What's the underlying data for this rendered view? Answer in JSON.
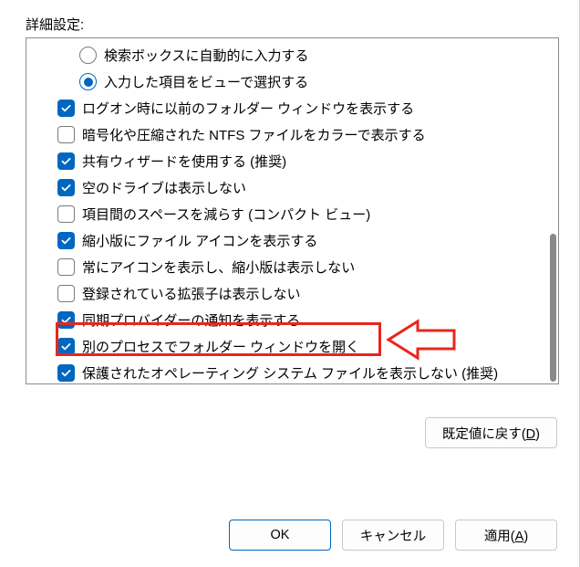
{
  "section_label": "詳細設定:",
  "options": [
    {
      "type": "radio",
      "checked": false,
      "sub": true,
      "label": "検索ボックスに自動的に入力する"
    },
    {
      "type": "radio",
      "checked": true,
      "sub": true,
      "label": "入力した項目をビューで選択する"
    },
    {
      "type": "checkbox",
      "checked": true,
      "sub": false,
      "label": "ログオン時に以前のフォルダー ウィンドウを表示する"
    },
    {
      "type": "checkbox",
      "checked": false,
      "sub": false,
      "label": "暗号化や圧縮された NTFS ファイルをカラーで表示する"
    },
    {
      "type": "checkbox",
      "checked": true,
      "sub": false,
      "label": "共有ウィザードを使用する (推奨)"
    },
    {
      "type": "checkbox",
      "checked": true,
      "sub": false,
      "label": "空のドライブは表示しない"
    },
    {
      "type": "checkbox",
      "checked": false,
      "sub": false,
      "label": "項目間のスペースを減らす (コンパクト ビュー)"
    },
    {
      "type": "checkbox",
      "checked": true,
      "sub": false,
      "label": "縮小版にファイル アイコンを表示する"
    },
    {
      "type": "checkbox",
      "checked": false,
      "sub": false,
      "label": "常にアイコンを表示し、縮小版は表示しない"
    },
    {
      "type": "checkbox",
      "checked": false,
      "sub": false,
      "label": "登録されている拡張子は表示しない"
    },
    {
      "type": "checkbox",
      "checked": true,
      "sub": false,
      "label": "同期プロバイダーの通知を表示する"
    },
    {
      "type": "checkbox",
      "checked": true,
      "sub": false,
      "label": "別のプロセスでフォルダー ウィンドウを開く"
    },
    {
      "type": "checkbox",
      "checked": true,
      "sub": false,
      "label": "保護されたオペレーティング システム ファイルを表示しない (推奨)"
    }
  ],
  "buttons": {
    "restore_defaults_prefix": "既定値に戻す(",
    "restore_defaults_accel": "D",
    "restore_defaults_suffix": ")",
    "ok": "OK",
    "cancel": "キャンセル",
    "apply_prefix": "適用(",
    "apply_accel": "A",
    "apply_suffix": ")"
  },
  "annotation": {
    "highlighted_index": 11,
    "arrow_color": "#e8261c"
  }
}
